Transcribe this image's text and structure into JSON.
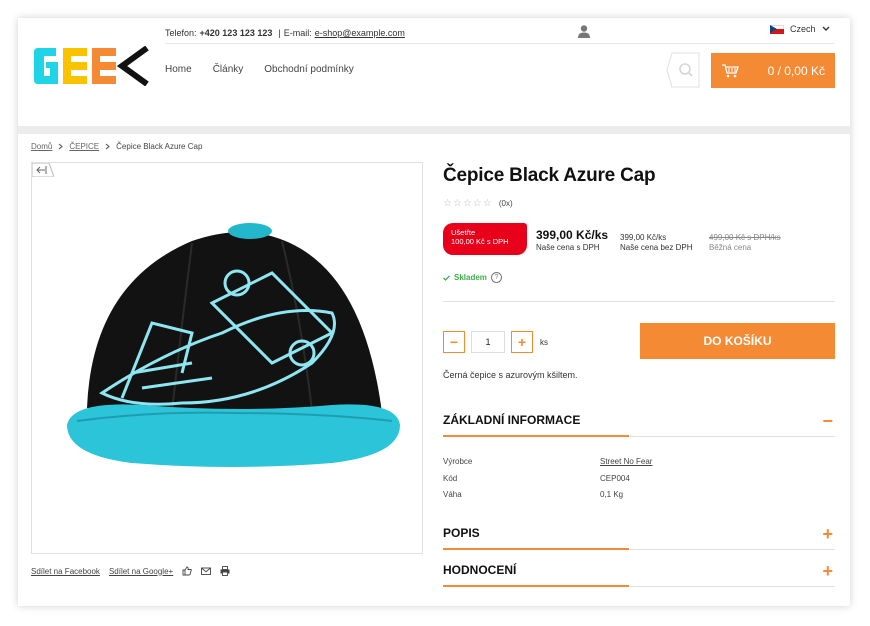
{
  "header": {
    "phone_label": "Telefon:",
    "phone": "+420 123 123 123",
    "separator": "|",
    "email_label": "E-mail:",
    "email": "e-shop@example.com",
    "language": "Czech",
    "nav": [
      "Home",
      "Články",
      "Obchodní podmínky"
    ],
    "cart_count": "0",
    "cart_sep": "/",
    "cart_total": "0,00 Kč",
    "logo_text": "GEEK"
  },
  "breadcrumb": [
    "Domů",
    "ČEPICE",
    "Čepice Black Azure Cap"
  ],
  "share": {
    "facebook": "Sdílet na Facebook",
    "google": "Sdílet na Google+"
  },
  "product": {
    "title": "Čepice Black Azure Cap",
    "rating_count": "(0x)",
    "save_line1": "Ušetřte",
    "save_line2": "100,00 Kč s DPH",
    "price": "399,00 Kč/ks",
    "price_label": "Naše cena s DPH",
    "price_nov": "399,00 Kč/ks",
    "price_nov_label": "Naše cena bez DPH",
    "price_common": "499,00 Kč s DPH/ks",
    "price_common_label": "Běžná cena",
    "stock": "Skladem",
    "qty": "1",
    "unit": "ks",
    "add_to_cart": "DO KOŠÍKU",
    "short_description": "Černá čepice s azurovým kšiltem."
  },
  "sections": {
    "basic": "ZÁKLADNÍ INFORMACE",
    "description": "POPIS",
    "rating": "HODNOCENÍ"
  },
  "info": [
    {
      "key": "Výrobce",
      "value": "Street No Fear"
    },
    {
      "key": "Kód",
      "value": "CEP004"
    },
    {
      "key": "Váha",
      "value": "0,1 Kg"
    }
  ],
  "colors": {
    "accent": "#f58a35",
    "sale": "#e8001a",
    "stock": "#3fae49",
    "logo_cyan": "#1ed4e6",
    "logo_yellow": "#f9c300",
    "logo_orange": "#f58a35"
  }
}
